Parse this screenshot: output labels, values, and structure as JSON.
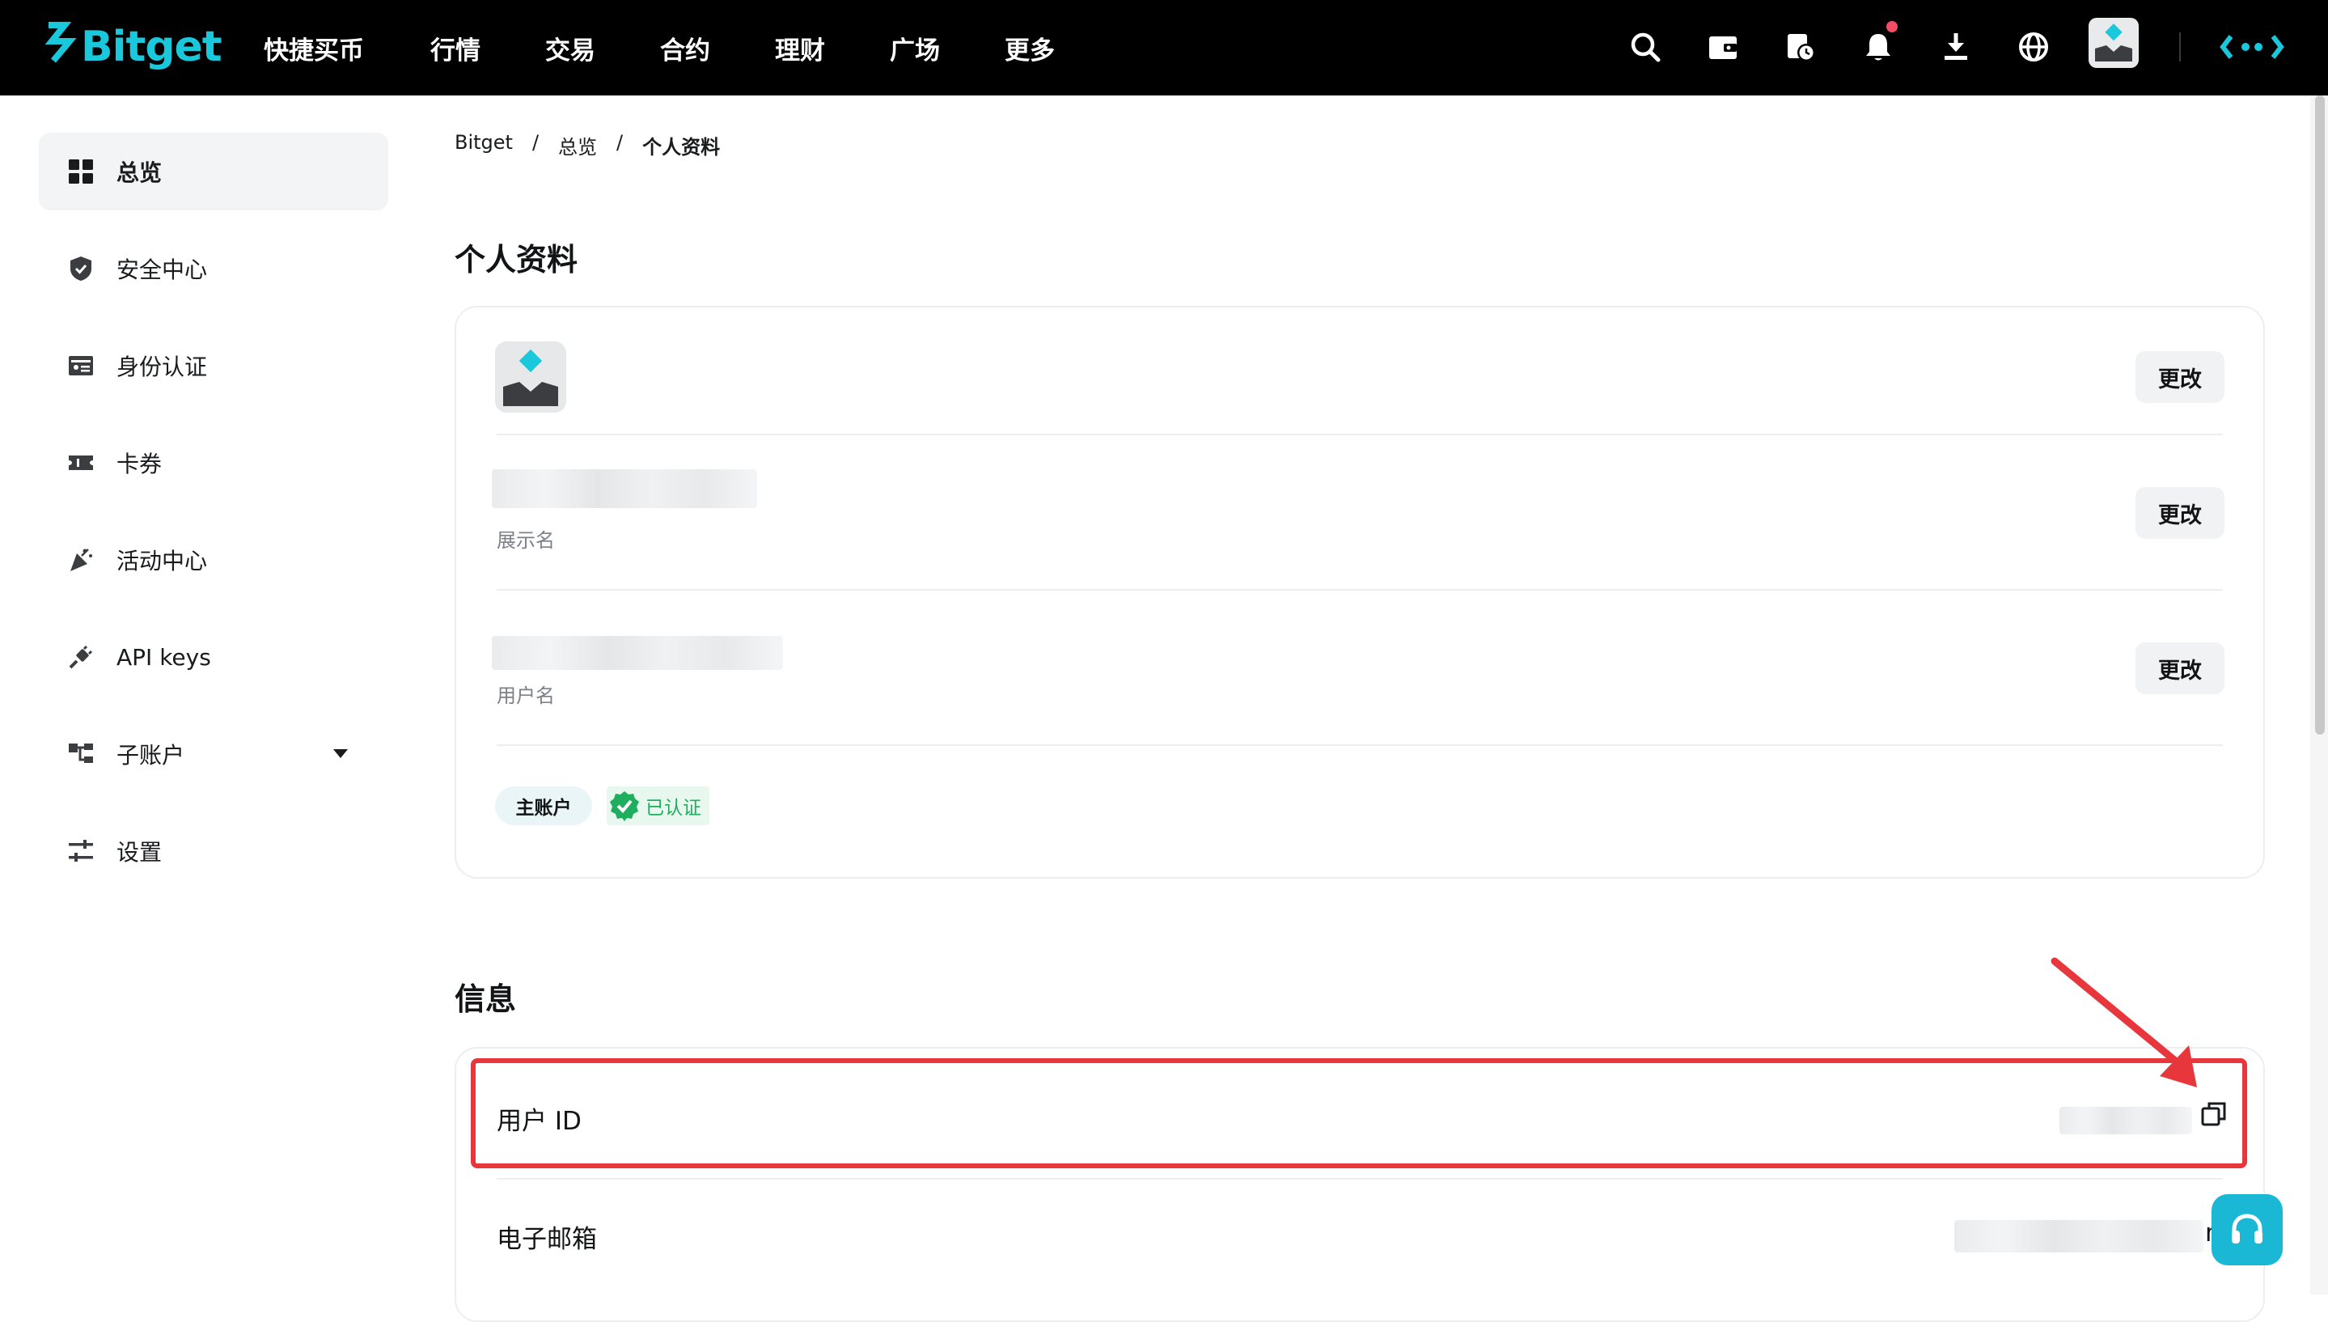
{
  "brand": {
    "name": "Bitget",
    "accent": "#1ac8dc",
    "alert": "#e8363d",
    "verified": "#1fae5e"
  },
  "nav": {
    "items": [
      "快捷买币",
      "行情",
      "交易",
      "合约",
      "理财",
      "广场",
      "更多"
    ]
  },
  "top_icons": [
    "search-icon",
    "wallet-icon",
    "orders-icon",
    "bell-icon",
    "download-icon",
    "globe-icon",
    "avatar",
    "more-icon"
  ],
  "sidebar": {
    "items": [
      {
        "label": "总览",
        "icon": "grid-icon",
        "active": true
      },
      {
        "label": "安全中心",
        "icon": "shield-icon"
      },
      {
        "label": "身份认证",
        "icon": "id-card-icon"
      },
      {
        "label": "卡券",
        "icon": "ticket-icon"
      },
      {
        "label": "活动中心",
        "icon": "party-icon"
      },
      {
        "label": "API keys",
        "icon": "plug-icon"
      },
      {
        "label": "子账户",
        "icon": "sub-account-icon",
        "has_caret": true
      },
      {
        "label": "设置",
        "icon": "sliders-icon"
      }
    ]
  },
  "breadcrumb": [
    "Bitget",
    "/",
    "总览",
    "/",
    "个人资料"
  ],
  "profile": {
    "title": "个人资料",
    "change_label": "更改",
    "display_name_label": "展示名",
    "username_label": "用户名",
    "account_tag": "主账户",
    "verified_tag": "已认证"
  },
  "info": {
    "title": "信息",
    "user_id_label": "用户 ID",
    "email_label": "电子邮箱",
    "email_suffix": "m"
  }
}
